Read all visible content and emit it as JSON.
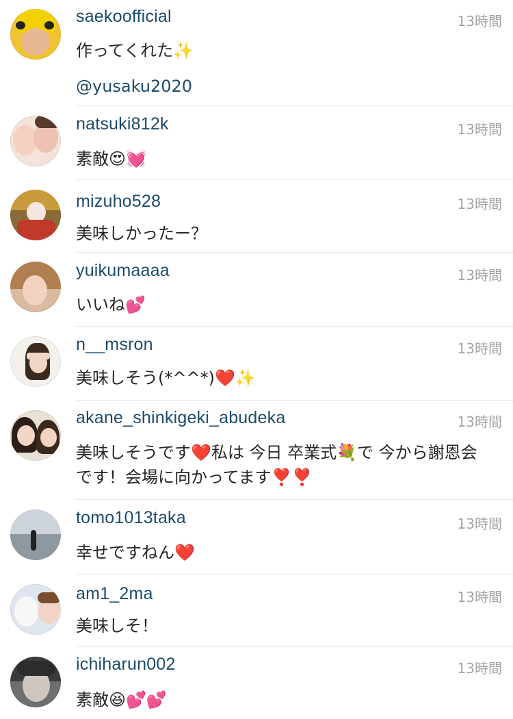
{
  "comments": [
    {
      "username": "saekoofficial",
      "time": "13時間",
      "text": "作ってくれた✨",
      "mention": "@yusaku2020"
    },
    {
      "username": "natsuki812k",
      "time": "13時間",
      "text": "素敵😍💓"
    },
    {
      "username": "mizuho528",
      "time": "13時間",
      "text": "美味しかったー？"
    },
    {
      "username": "yuikumaaaa",
      "time": "13時間",
      "text": "いいね💕"
    },
    {
      "username": "n__msron",
      "time": "13時間",
      "text": "美味しそう(*^^*)❤️✨"
    },
    {
      "username": "akane_shinkigeki_abudeka",
      "time": "13時間",
      "text": "美味しそうです❤️私は 今日 卒業式💐で 今から謝恩会です！会場に向かってます❣️❣️"
    },
    {
      "username": "tomo1013taka",
      "time": "13時間",
      "text": "幸せですねん❤️"
    },
    {
      "username": "am1_2ma",
      "time": "13時間",
      "text": "美味しそ！"
    },
    {
      "username": "ichiharun002",
      "time": "13時間",
      "text": "素敵😆💕💕"
    }
  ],
  "icons": {
    "avatar": "user-avatar-photo"
  }
}
